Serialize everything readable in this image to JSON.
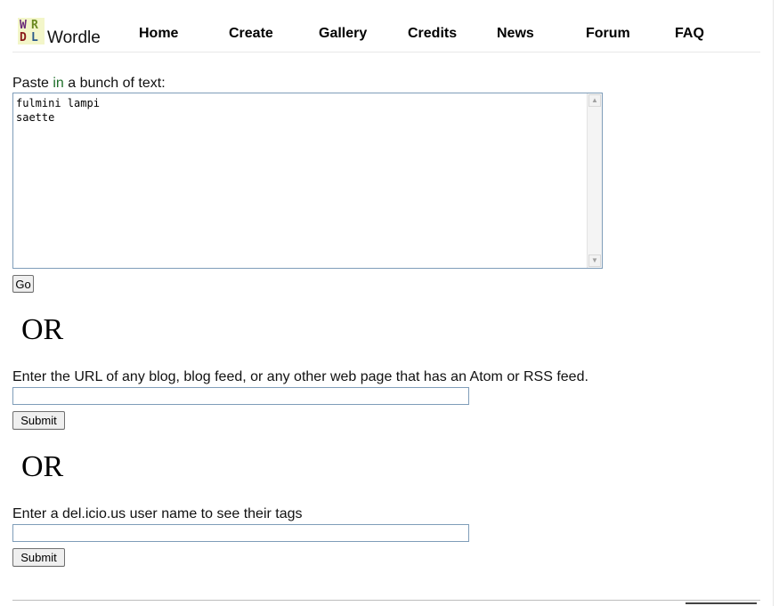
{
  "logo": {
    "mark_letters": [
      "W",
      "R",
      "D",
      "L"
    ],
    "text": "Wordle",
    "colors": {
      "background": "#f3f6c9",
      "W": "#6a2a7a",
      "R": "#6a8a20",
      "D": "#8a1a1a",
      "L": "#2a5a8a"
    }
  },
  "nav": {
    "home": "Home",
    "create": "Create",
    "gallery": "Gallery",
    "credits": "Credits",
    "news": "News",
    "forum": "Forum",
    "faq": "FAQ"
  },
  "paste": {
    "label_start": "Paste ",
    "label_highlight": "in",
    "label_end": " a bunch of text:",
    "text_value": "fulmini lampi\nsaette",
    "go_label": "Go"
  },
  "or_label": "OR",
  "url_section": {
    "label": "Enter the URL of any blog, blog feed, or any other web page that has an Atom or RSS feed.",
    "input_value": "",
    "submit_label": "Submit"
  },
  "delicious_section": {
    "label": "Enter a del.icio.us user name to see their tags",
    "input_value": "",
    "submit_label": "Submit"
  },
  "colors": {
    "input_border": "#7f9db9",
    "highlight_text": "#1f6f2a"
  }
}
